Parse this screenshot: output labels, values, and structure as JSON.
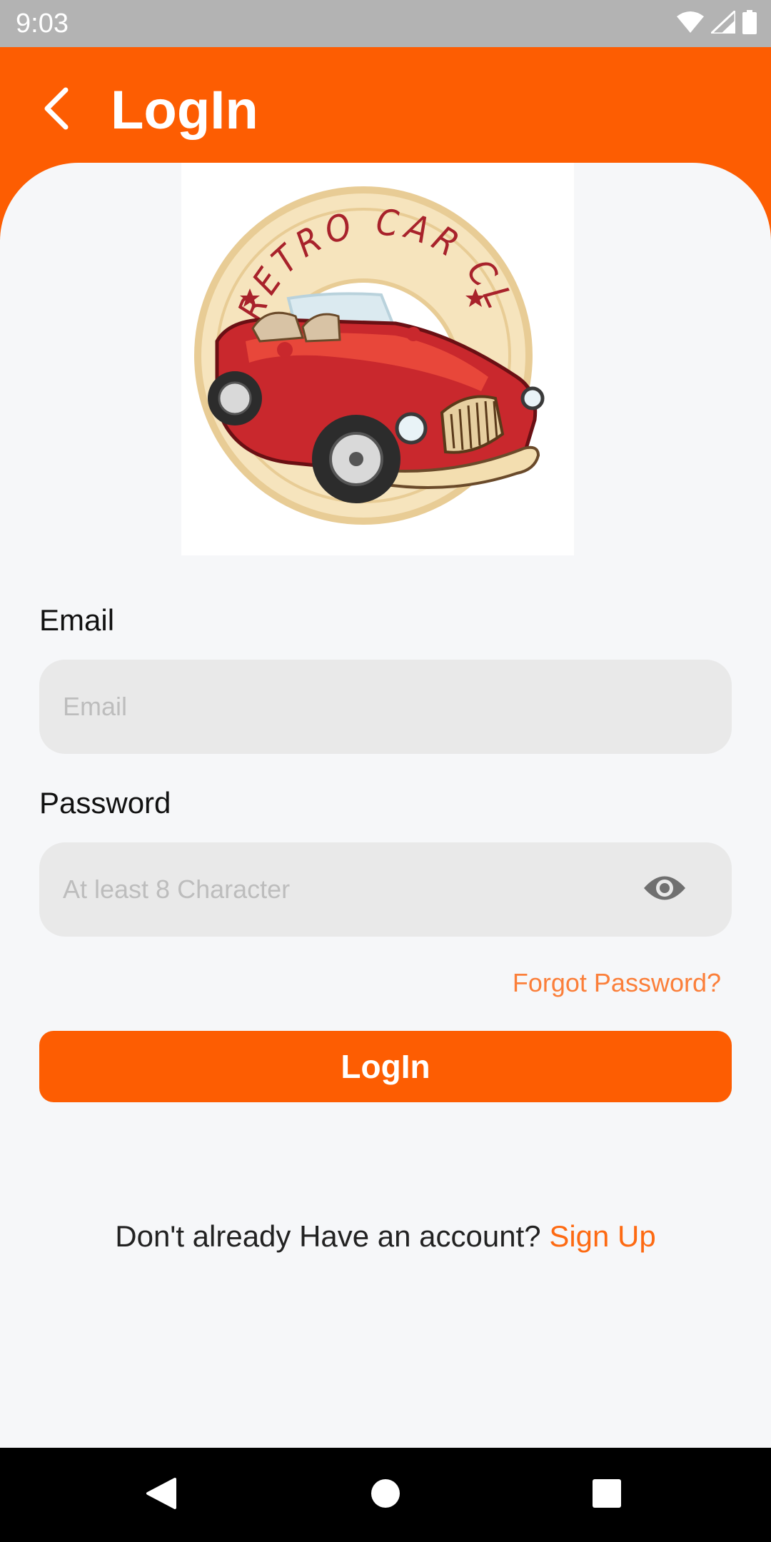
{
  "status_bar": {
    "time": "9:03",
    "icons": [
      "wifi-icon",
      "cellular-signal-icon",
      "battery-icon"
    ]
  },
  "header": {
    "title": "LogIn",
    "back_icon": "chevron-left-icon",
    "background_color": "#fd5d02"
  },
  "logo": {
    "text": "RETRO CAR CLUB",
    "description_icon": "retro-car-logo"
  },
  "form": {
    "email": {
      "label": "Email",
      "placeholder": "Email",
      "value": ""
    },
    "password": {
      "label": "Password",
      "placeholder": "At least 8 Character",
      "value": "",
      "toggle_icon": "eye-icon"
    },
    "forgot_password": "Forgot Password?",
    "submit_label": "LogIn"
  },
  "signup": {
    "prompt": "Don't already Have an account?",
    "link_label": "Sign Up"
  },
  "nav_bar": {
    "icons": [
      "back-triangle-icon",
      "home-circle-icon",
      "recents-square-icon"
    ]
  },
  "colors": {
    "accent": "#fd5d02",
    "link": "#fb7f3a",
    "input_bg": "#e9e9e9",
    "page_bg": "#f6f7f9"
  }
}
